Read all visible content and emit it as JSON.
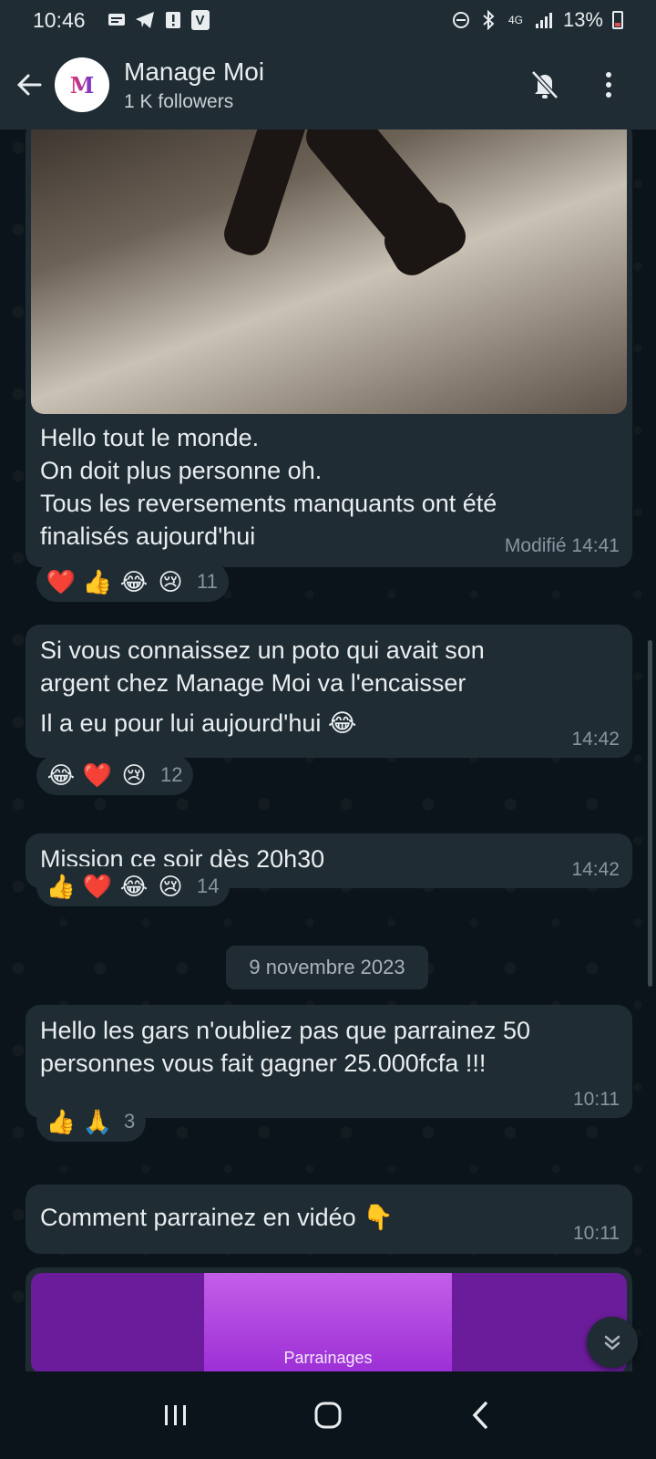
{
  "status_bar": {
    "time": "10:46",
    "battery": "13%",
    "network": "4G"
  },
  "header": {
    "title": "Manage Moi",
    "subtitle": "1 K followers",
    "avatar_letter": "M"
  },
  "messages": [
    {
      "text_lines": [
        "Hello tout le monde.",
        "On doit plus personne oh.",
        "Tous les reversements manquants ont été",
        "finalisés aujourd'hui"
      ],
      "time": "Modifié 14:41",
      "reactions": [
        "❤️",
        "👍",
        "😂",
        "😢"
      ],
      "reaction_count": "11"
    },
    {
      "text_lines": [
        "Si vous connaissez un poto qui avait son",
        "argent chez Manage Moi va l'encaisser",
        "Il a eu pour lui aujourd'hui 😂"
      ],
      "time": "14:42",
      "reactions": [
        "😂",
        "❤️",
        "😢"
      ],
      "reaction_count": "12"
    },
    {
      "text_lines": [
        "Mission ce soir dès 20h30"
      ],
      "time": "14:42",
      "reactions": [
        "👍",
        "❤️",
        "😂",
        "😢"
      ],
      "reaction_count": "14"
    },
    {
      "text_lines": [
        "Hello les gars n'oubliez pas que parrainez 50",
        "personnes vous fait gagner 25.000fcfa !!!"
      ],
      "time": "10:11",
      "reactions": [
        "👍",
        "🙏"
      ],
      "reaction_count": "3"
    },
    {
      "text_lines": [
        "Comment parrainez en vidéo 👇"
      ],
      "time": "10:11"
    }
  ],
  "date_separator": "9 novembre 2023",
  "video_caption": "Parrainages",
  "colors": {
    "background": "#0b141a",
    "bubble": "#1f2c34",
    "header": "#1f2c34",
    "time_text": "#8696a0"
  },
  "icons": [
    "back-arrow-icon",
    "mute-bell-icon",
    "more-vert-icon",
    "scroll-down-icon",
    "recent-apps-icon",
    "home-icon",
    "back-nav-icon"
  ]
}
